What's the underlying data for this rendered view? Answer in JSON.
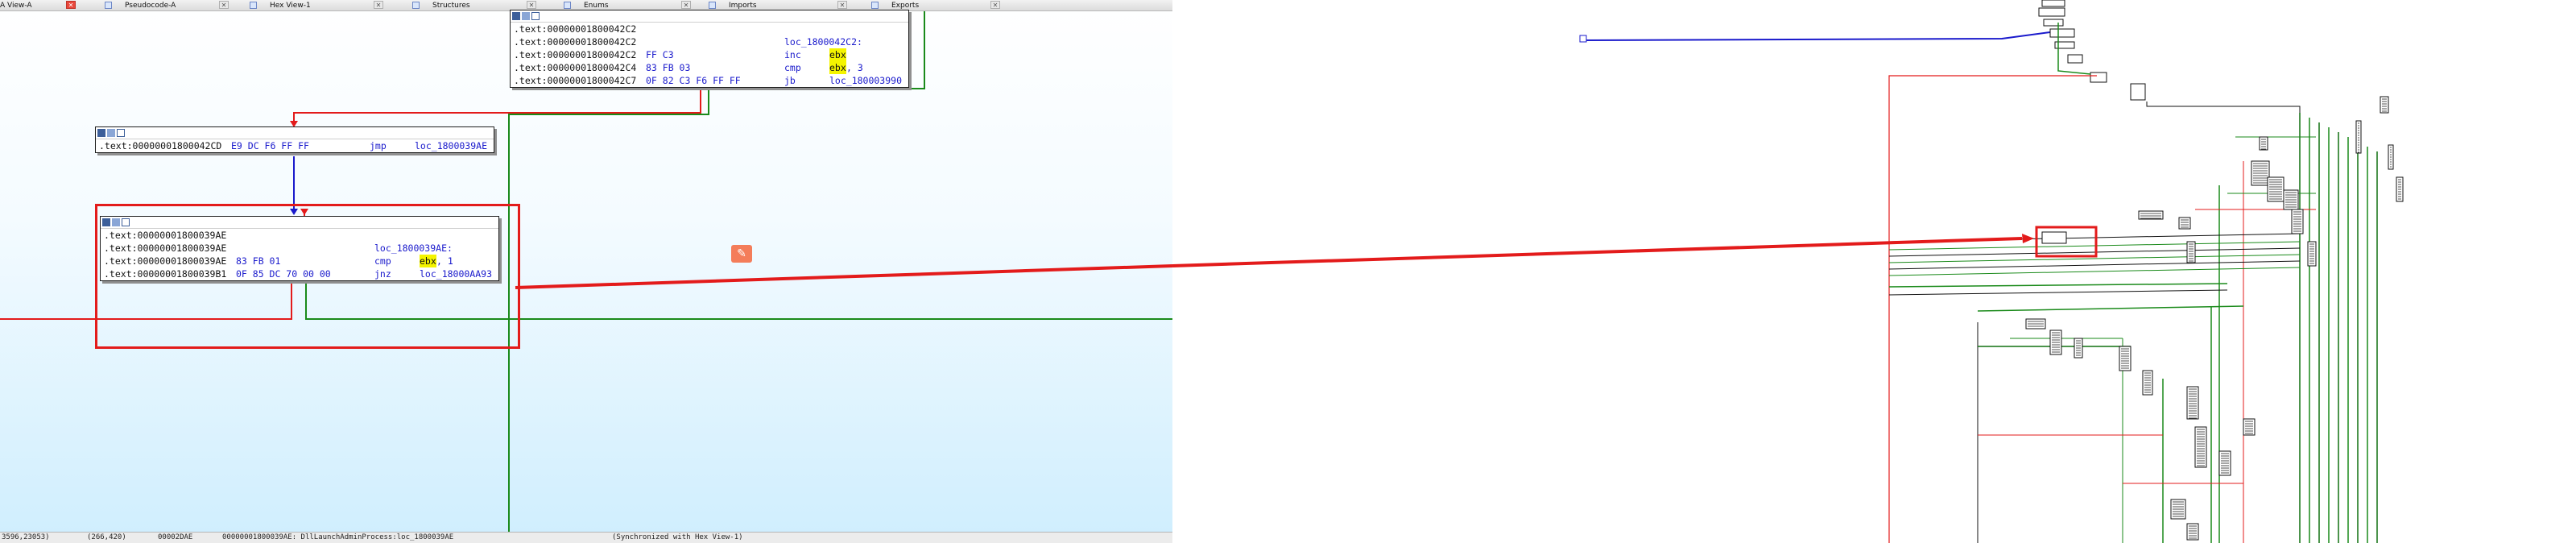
{
  "tabs": [
    {
      "label": "A View-A",
      "active": true
    },
    {
      "label": "Pseudocode-A"
    },
    {
      "label": "Hex View-1"
    },
    {
      "label": "Structures"
    },
    {
      "label": "Enums"
    },
    {
      "label": "Imports"
    },
    {
      "label": "Exports"
    }
  ],
  "close_glyph": "✕",
  "node_top": {
    "lines": [
      {
        "addr": ".text:00000001800042C2",
        "bytes": "",
        "mnem": "",
        "oper": "",
        "hl": ""
      },
      {
        "addr": ".text:00000001800042C2",
        "bytes": "",
        "mnem": "loc_1800042C2:",
        "oper": "",
        "hl": ""
      },
      {
        "addr": ".text:00000001800042C2",
        "bytes": "FF C3",
        "mnem": "inc",
        "oper": "",
        "hl": "ebx"
      },
      {
        "addr": ".text:00000001800042C4",
        "bytes": "83 FB 03",
        "mnem": "cmp",
        "oper": ", 3",
        "hl": "ebx"
      },
      {
        "addr": ".text:00000001800042C7",
        "bytes": "0F 82 C3 F6 FF FF",
        "mnem": "jb",
        "oper": "loc_180003990",
        "hl": ""
      }
    ]
  },
  "node_jmp": {
    "lines": [
      {
        "addr": ".text:00000001800042CD",
        "bytes": "E9 DC F6 FF FF",
        "mnem": "jmp",
        "oper": "loc_1800039AE",
        "hl": ""
      }
    ]
  },
  "node_main": {
    "lines": [
      {
        "addr": ".text:00000001800039AE",
        "bytes": "",
        "mnem": "",
        "oper": "",
        "hl": ""
      },
      {
        "addr": ".text:00000001800039AE",
        "bytes": "",
        "mnem": "loc_1800039AE:",
        "oper": "",
        "hl": ""
      },
      {
        "addr": ".text:00000001800039AE",
        "bytes": "83 FB 01",
        "mnem": "cmp",
        "oper": ", 1",
        "hl": "ebx"
      },
      {
        "addr": ".text:00000001800039B1",
        "bytes": "0F 85 DC 70 00 00",
        "mnem": "jnz",
        "oper": "loc_18000AA93",
        "hl": ""
      }
    ]
  },
  "status": {
    "coords": "3596,23053)",
    "zoom_coords": "(266,420)",
    "offset": "00002DAE",
    "location": "00000001800039AE: DllLaunchAdminProcess:loc_1800039AE",
    "sync": "(Synchronized with Hex View-1)"
  },
  "colors": {
    "selection": "#e31b1b",
    "edge_true": "#1a8a1a",
    "edge_false": "#e31b1b",
    "edge_uncond": "#1a1acc",
    "operand_highlight": "#f4f400"
  },
  "icons": [
    "disasm-view-icon",
    "pseudocode-icon",
    "hex-view-icon",
    "structures-icon",
    "enums-icon",
    "imports-icon",
    "exports-icon",
    "edit-icon"
  ]
}
